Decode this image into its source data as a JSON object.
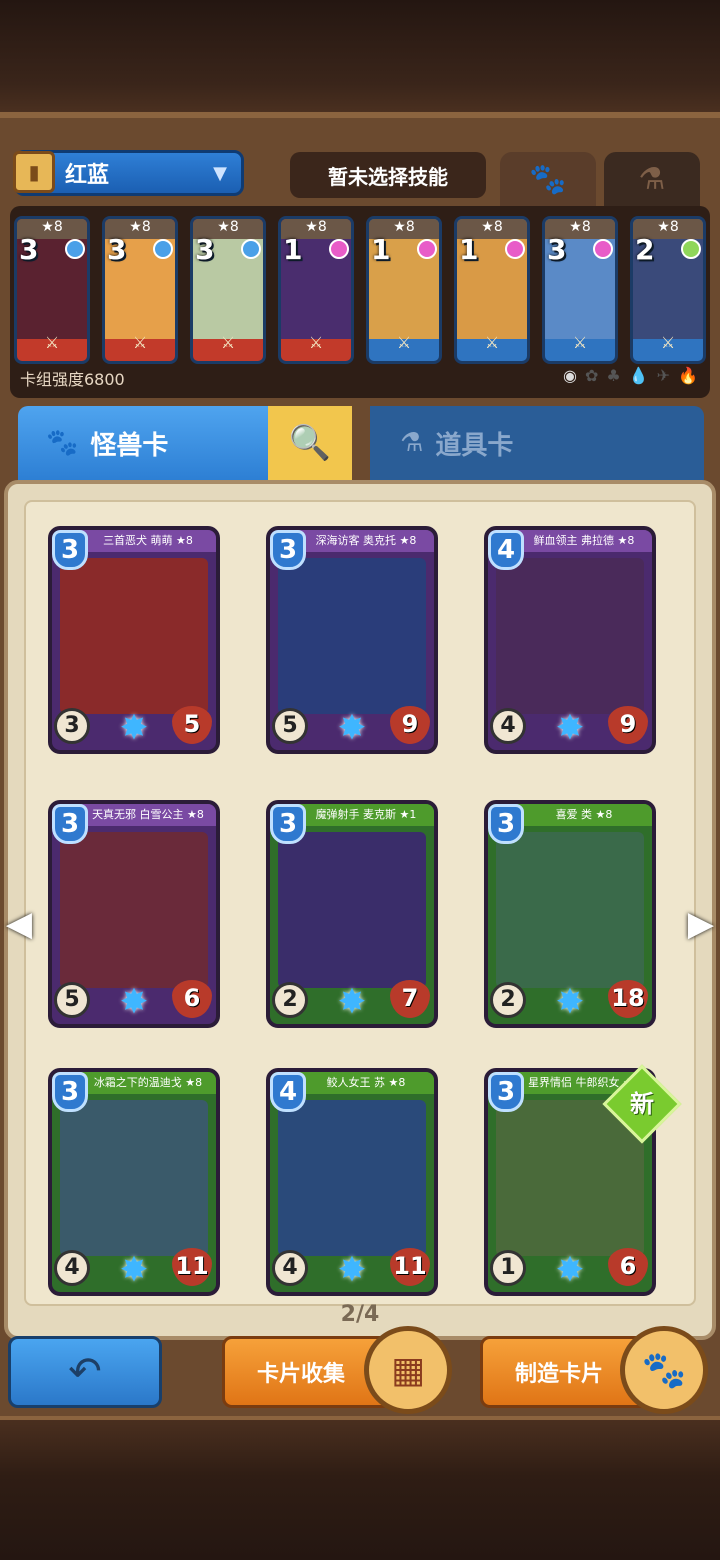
{
  "deck": {
    "name": "红蓝",
    "skill_status": "暂未选择技能",
    "power_label": "卡组强度6800",
    "cards": [
      {
        "stars": "★8",
        "cost": "3",
        "color": "#c23a2a",
        "art": "#5a2230",
        "gem": "#4aa0e8"
      },
      {
        "stars": "★8",
        "cost": "3",
        "color": "#c23a2a",
        "art": "#e6a04a",
        "gem": "#4aa0e8"
      },
      {
        "stars": "★8",
        "cost": "3",
        "color": "#c23a2a",
        "art": "#b9c9a3",
        "gem": "#4aa0e8"
      },
      {
        "stars": "★8",
        "cost": "1",
        "color": "#c23a2a",
        "art": "#4a2d6e",
        "gem": "#e85cc8"
      },
      {
        "stars": "★8",
        "cost": "1",
        "color": "#2f74c0",
        "art": "#d9a04a",
        "gem": "#e85cc8"
      },
      {
        "stars": "★8",
        "cost": "1",
        "color": "#2f74c0",
        "art": "#d99a46",
        "gem": "#e85cc8"
      },
      {
        "stars": "★8",
        "cost": "3",
        "color": "#2f74c0",
        "art": "#5a8ac7",
        "gem": "#e85cc8"
      },
      {
        "stars": "★8",
        "cost": "2",
        "color": "#2f74c0",
        "art": "#3a4a7a",
        "gem": "#8fd65a"
      }
    ]
  },
  "tabs": {
    "monster_label": "怪兽卡",
    "item_label": "道具卡"
  },
  "book": {
    "page": "2/4",
    "cards": [
      {
        "name": "三首恶犬 萌萌 ★8",
        "cost": "3",
        "atk": "3",
        "hp": "5",
        "theme": "purple",
        "art": "#8a2a2a"
      },
      {
        "name": "深海访客 奥克托 ★8",
        "cost": "3",
        "atk": "5",
        "hp": "9",
        "theme": "purple",
        "art": "#2a3d7a"
      },
      {
        "name": "鲜血领主 弗拉德 ★8",
        "cost": "4",
        "atk": "4",
        "hp": "9",
        "theme": "purple",
        "art": "#4a2a5a"
      },
      {
        "name": "天真无邪 白雪公主 ★8",
        "cost": "3",
        "atk": "5",
        "hp": "6",
        "theme": "purple",
        "art": "#6a2a3a"
      },
      {
        "name": "魔弹射手 麦克斯 ★1",
        "cost": "3",
        "atk": "2",
        "hp": "7",
        "theme": "green",
        "art": "#3a2d6a"
      },
      {
        "name": "喜爱 类 ★8",
        "cost": "3",
        "atk": "2",
        "hp": "18",
        "theme": "green",
        "art": "#3a6a4a"
      },
      {
        "name": "冰霜之下的温迪戈 ★8",
        "cost": "3",
        "atk": "4",
        "hp": "11",
        "theme": "green",
        "art": "#3a5a6a"
      },
      {
        "name": "鲛人女王 苏 ★8",
        "cost": "4",
        "atk": "4",
        "hp": "11",
        "theme": "green",
        "art": "#2a4a7a"
      },
      {
        "name": "星界情侣 牛郎织女 ★1",
        "cost": "3",
        "atk": "1",
        "hp": "6",
        "theme": "green",
        "art": "#4a6a3a"
      }
    ]
  },
  "badge": {
    "new": "新"
  },
  "buttons": {
    "collect": "卡片收集",
    "craft": "制造卡片"
  }
}
